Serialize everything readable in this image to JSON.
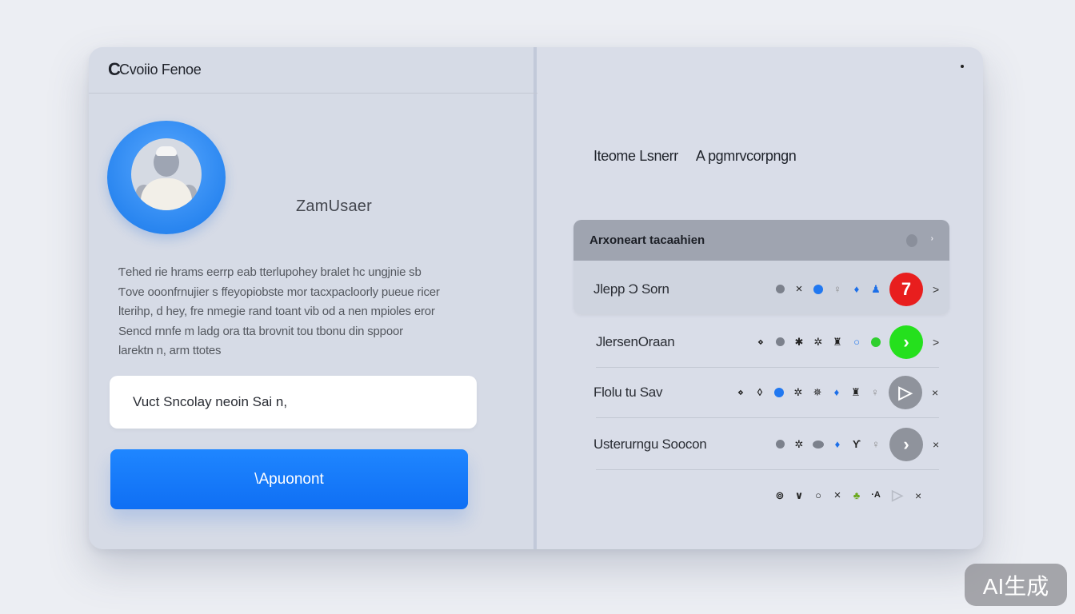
{
  "window": {
    "title": "Cvoiio Fenoe",
    "logo_icon": "c-logo-icon"
  },
  "profile": {
    "username": "ZamUsaer",
    "bio_lines": [
      "Ƭehed rie hrams eerrp eab tterlupohey bralet hc ungjnie sb",
      "Ƭove ooonfrnujier s ffeyopiobste mor tacxpacloorly pueue ricer",
      "lterihp, d hey, fre nmegie rand toant vib od a nen mpioles eror",
      "Sencd rnnfe m ladg ora tta brovnit tou tbonu din sppoor",
      "larektn n, arm ttotes"
    ],
    "input_value": "Vuct Sncolay neoin   Sai n,",
    "primary_button": "\\Apuonont"
  },
  "right": {
    "header_left": "Ιteome Lsnerr",
    "header_right": "A pgmrvcorpngn",
    "panel_header": "Arxoneart tacaahien",
    "rows": [
      {
        "name": "Jlepp Ɔ Sorn",
        "action_label": "7",
        "trail": ">"
      },
      {
        "name": "ЈlersenOraan",
        "action_label": "›",
        "trail": ">"
      },
      {
        "name": "Flolu tu Sav",
        "action_label": "▷",
        "trail": "×"
      },
      {
        "name": "Usterurngu Soocon",
        "action_label": "›",
        "trail": "×"
      },
      {
        "name": "",
        "action_label": "▷",
        "trail": "×"
      }
    ]
  },
  "watermark": "AI生成",
  "colors": {
    "accent": "#1f7ff8",
    "danger": "#e81e1e",
    "success": "#25e01d",
    "window_bg": "#d6dbe6"
  }
}
